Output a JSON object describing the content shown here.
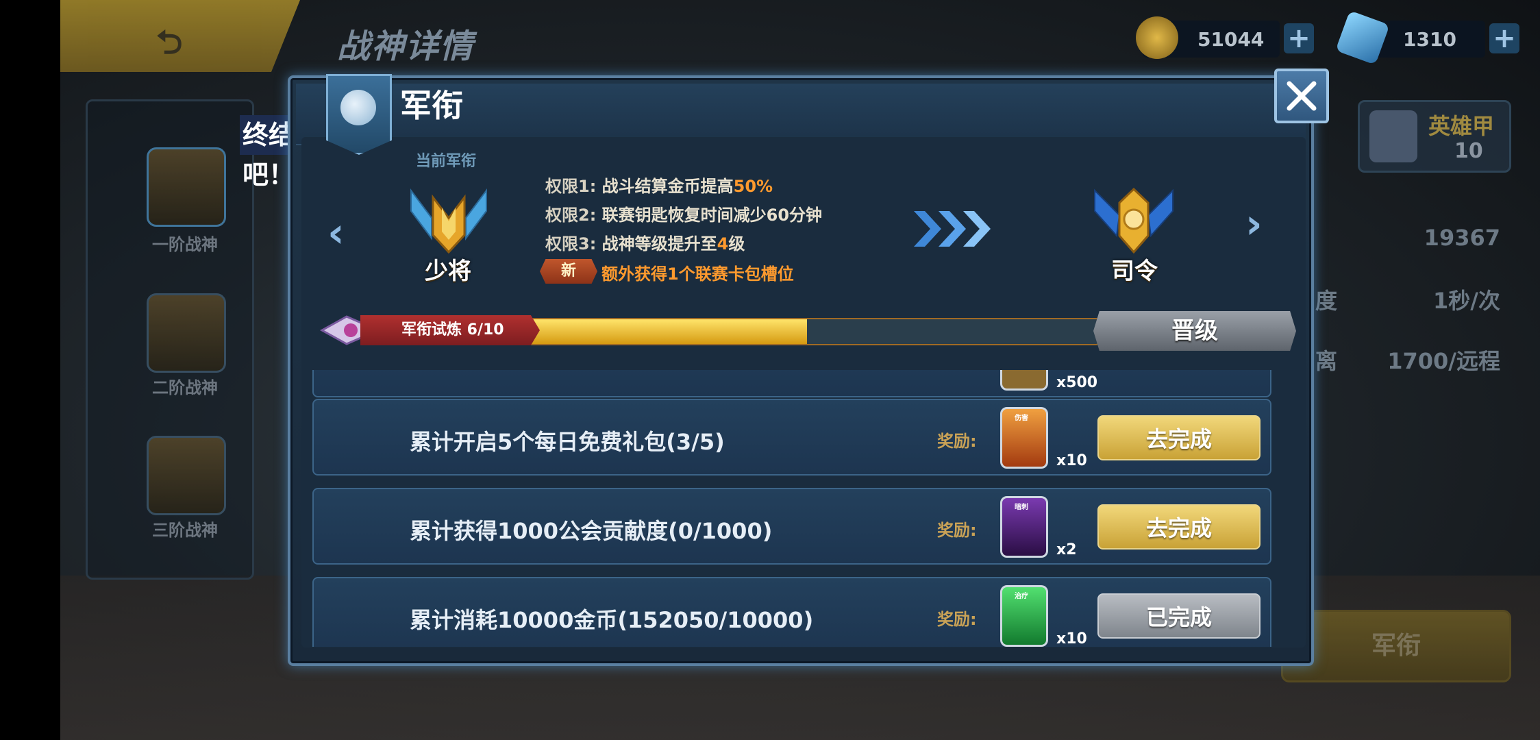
{
  "page": {
    "title": "战神详情",
    "currency": [
      {
        "icon": "gold-coin-icon",
        "amount": "51044"
      },
      {
        "icon": "diamond-icon",
        "amount": "1310"
      }
    ],
    "tooltip": "终结TA吧！",
    "side_tiers": [
      "一阶战神",
      "二阶战神",
      "三阶战神"
    ],
    "hero_armor": {
      "label": "英雄甲",
      "count": "10"
    },
    "stats": [
      {
        "key": "",
        "value": "19367"
      },
      {
        "key": "度",
        "value": "1秒/次"
      },
      {
        "key": "离",
        "value": "1700/远程"
      }
    ],
    "bottom_button": "军衔"
  },
  "dialog": {
    "title": "军衔",
    "current_rank_label": "当前军衔",
    "current_rank": "少将",
    "next_rank": "司令",
    "permissions": [
      {
        "label": "权限1:",
        "text": "战斗结算金币提高",
        "highlight": "50%",
        "suffix": ""
      },
      {
        "label": "权限2:",
        "text": "联赛钥匙恢复时间减少60分钟",
        "highlight": "",
        "suffix": ""
      },
      {
        "label": "权限3:",
        "text": "战神等级提升至",
        "highlight": "4",
        "suffix": "级"
      }
    ],
    "new_tag": "新",
    "new_permission": "额外获得1个联赛卡包槽位",
    "trial": {
      "label": "军衔试炼 6/10",
      "progress": 0.6
    },
    "promote_button": "晋级",
    "partial_qty": "x500",
    "tasks": [
      {
        "desc": "累计开启5个每日免费礼包(3/5)",
        "reward_label": "奖励:",
        "card_tag": "伤害",
        "qty": "x10",
        "action": "去完成",
        "state": "go",
        "card_color": "#d8742a"
      },
      {
        "desc": "累计获得1000公会贡献度(0/1000)",
        "reward_label": "奖励:",
        "card_tag": "暗刺",
        "qty": "x2",
        "action": "去完成",
        "state": "go",
        "card_color": "#5a2a8a"
      },
      {
        "desc": "累计消耗10000金币(152050/10000)",
        "reward_label": "奖励:",
        "card_tag": "治疗",
        "qty": "x10",
        "action": "已完成",
        "state": "done",
        "card_color": "#2aa048"
      }
    ]
  }
}
